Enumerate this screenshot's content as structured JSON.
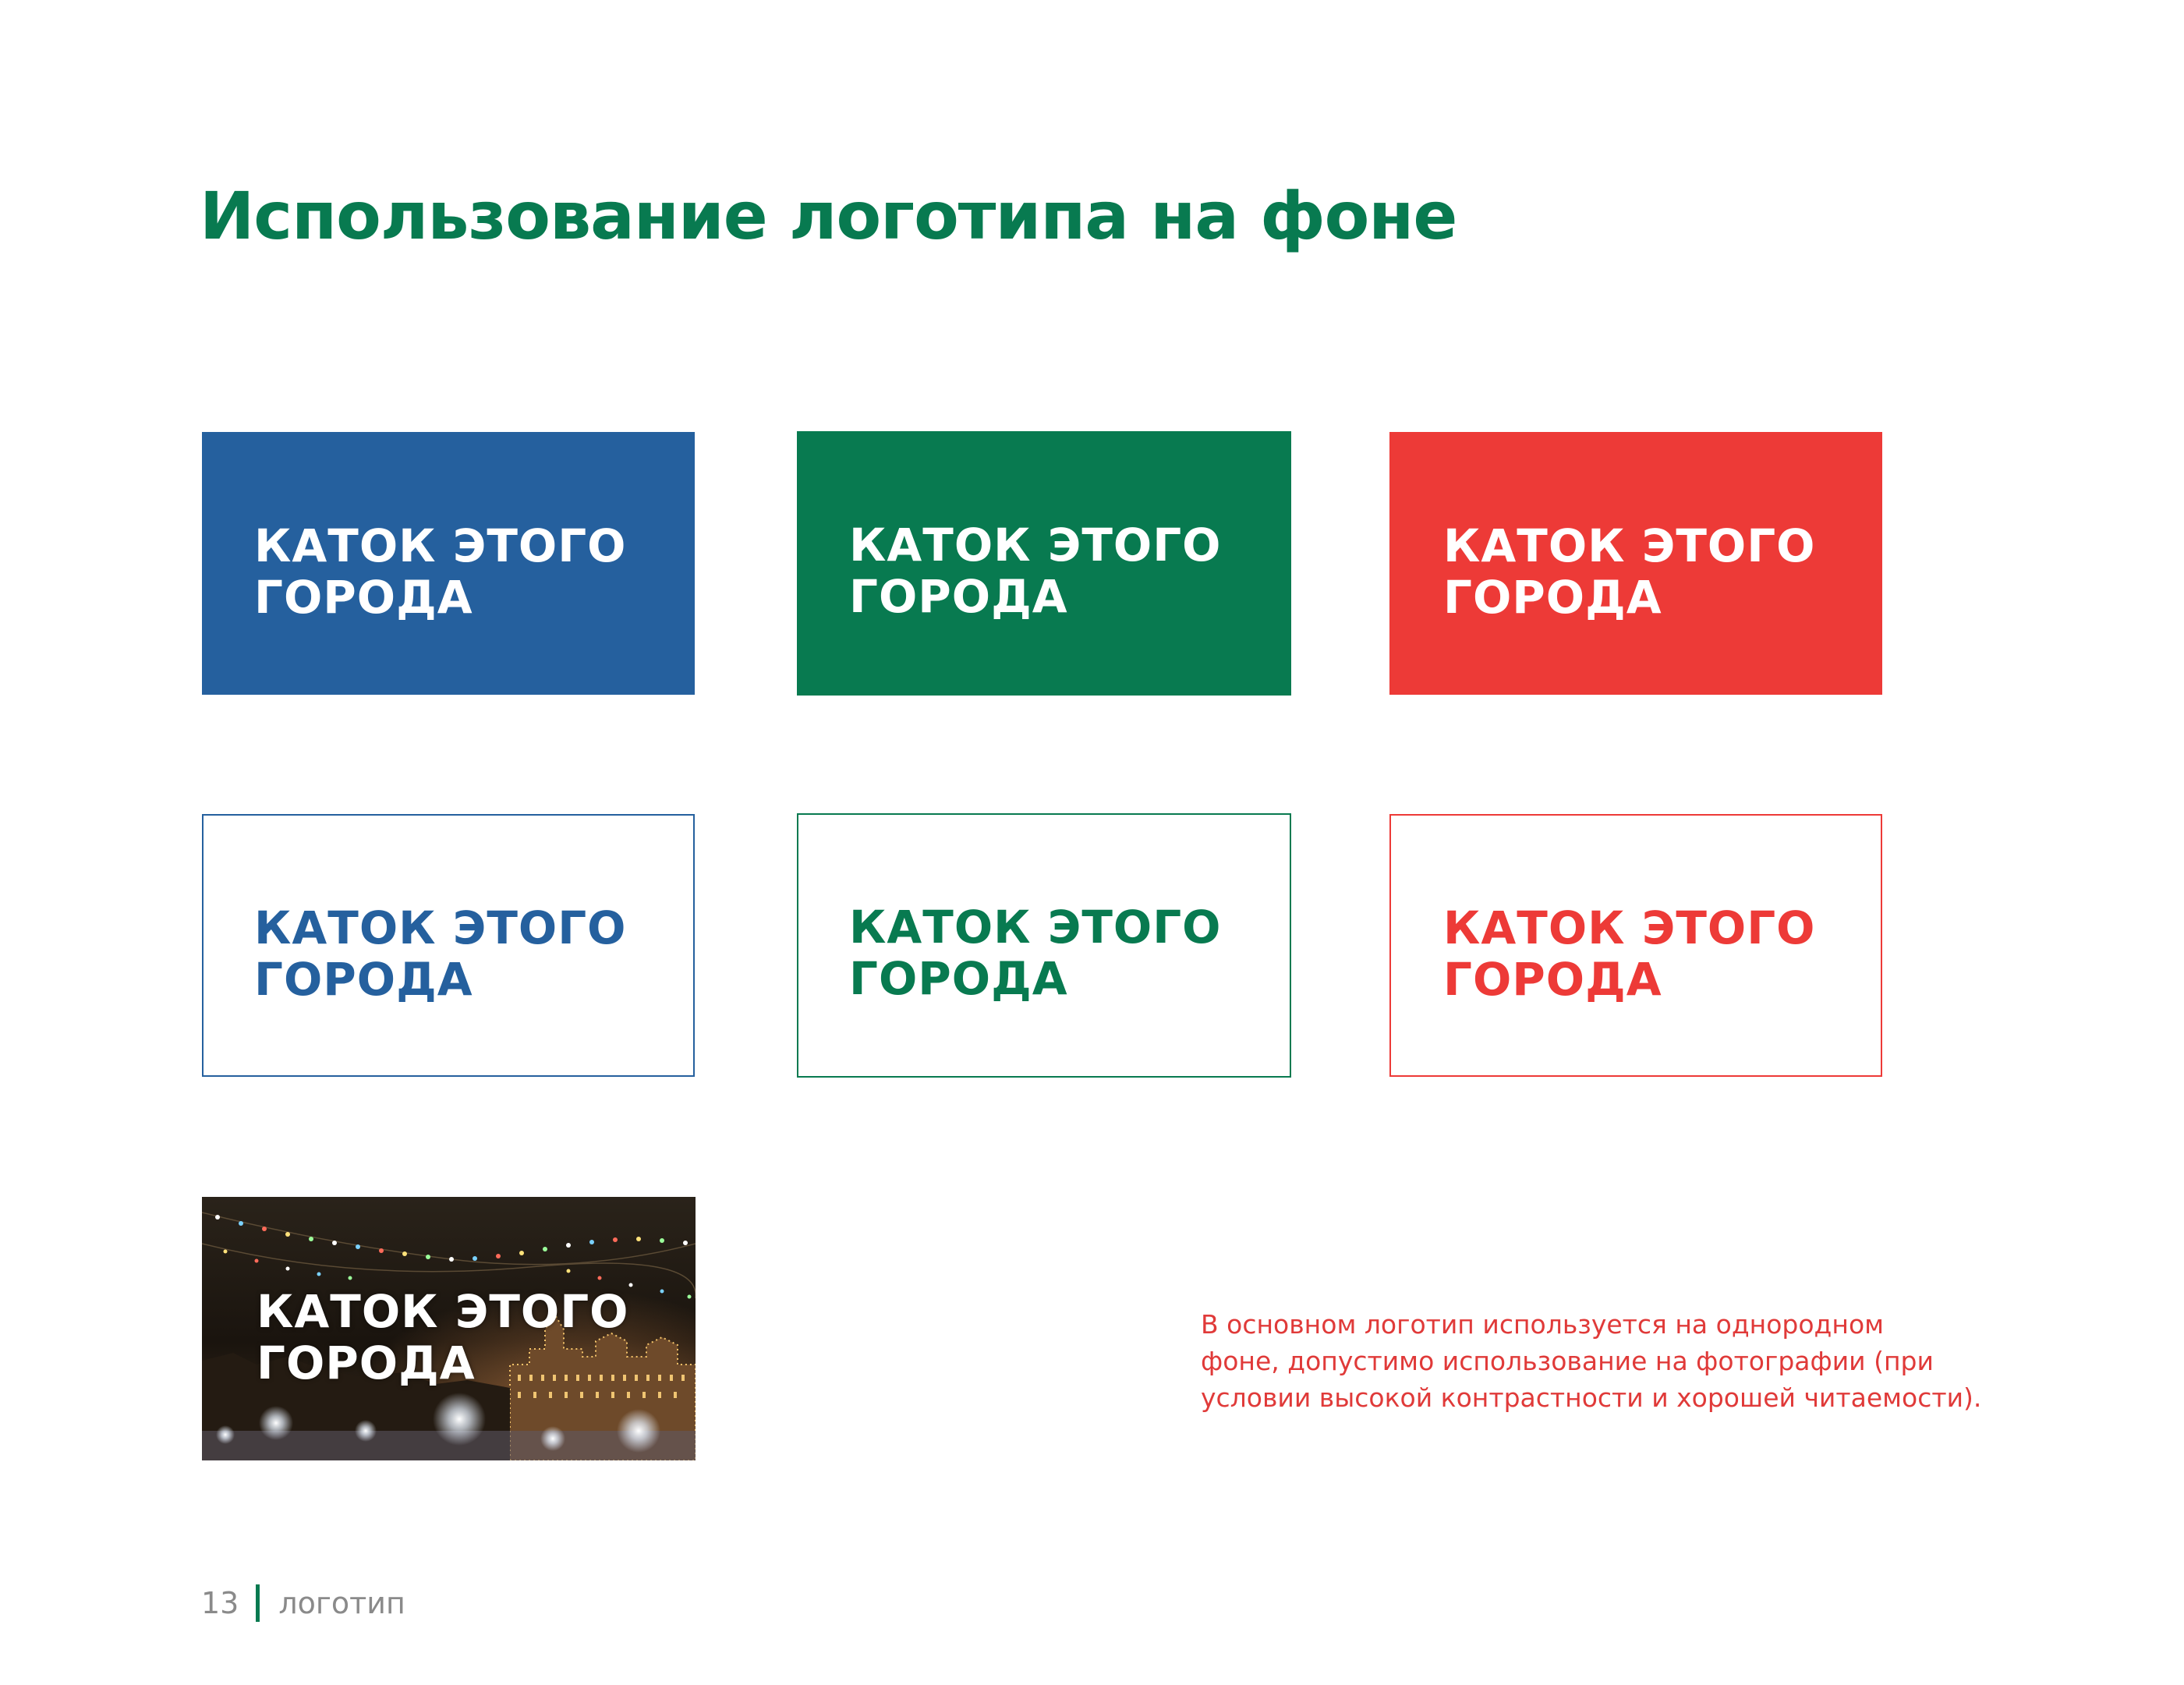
{
  "title": "Использование логотипа на фоне",
  "logo": {
    "line1": "КАТОК ЭТОГО",
    "line2": "ГОРОДА"
  },
  "colors": {
    "blue": "#25609e",
    "green": "#087a50",
    "red": "#ed3a37",
    "note": "#e03a39"
  },
  "note": {
    "line1": "В основном логотип используется на однородном",
    "line2": "фоне, допустимо использование на фотографии (при",
    "line3": "условии высокой контрастности и хорошей читаемости)."
  },
  "footer": {
    "page_number": "13",
    "section": "логотип"
  }
}
